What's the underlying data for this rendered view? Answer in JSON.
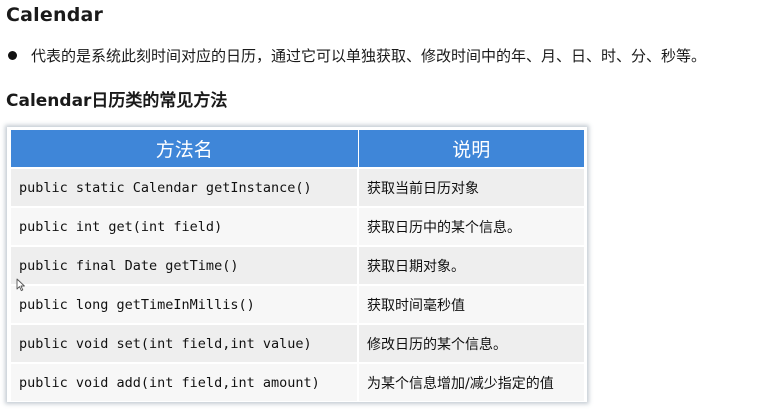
{
  "title": "Calendar",
  "bullet_text": "代表的是系统此刻时间对应的日历，通过它可以单独获取、修改时间中的年、月、日、时、分、秒等。",
  "subtitle": "Calendar日历类的常见方法",
  "table": {
    "headers": [
      "方法名",
      "说明"
    ],
    "rows": [
      {
        "method": "public static Calendar getInstance()",
        "desc": "获取当前日历对象"
      },
      {
        "method": "public int get(int field)",
        "desc": "获取日历中的某个信息。"
      },
      {
        "method": "public final Date getTime()",
        "desc": "获取日期对象。"
      },
      {
        "method": "public long getTimeInMillis()",
        "desc": "获取时间毫秒值"
      },
      {
        "method": "public void set(int field,int value)",
        "desc": "修改日历的某个信息。"
      },
      {
        "method": "public void add(int field,int amount)",
        "desc": "为某个信息增加/减少指定的值"
      }
    ]
  },
  "colors": {
    "header_bg": "#3f86d8",
    "row_odd": "#eeeeee",
    "row_even": "#f7f7f7"
  }
}
